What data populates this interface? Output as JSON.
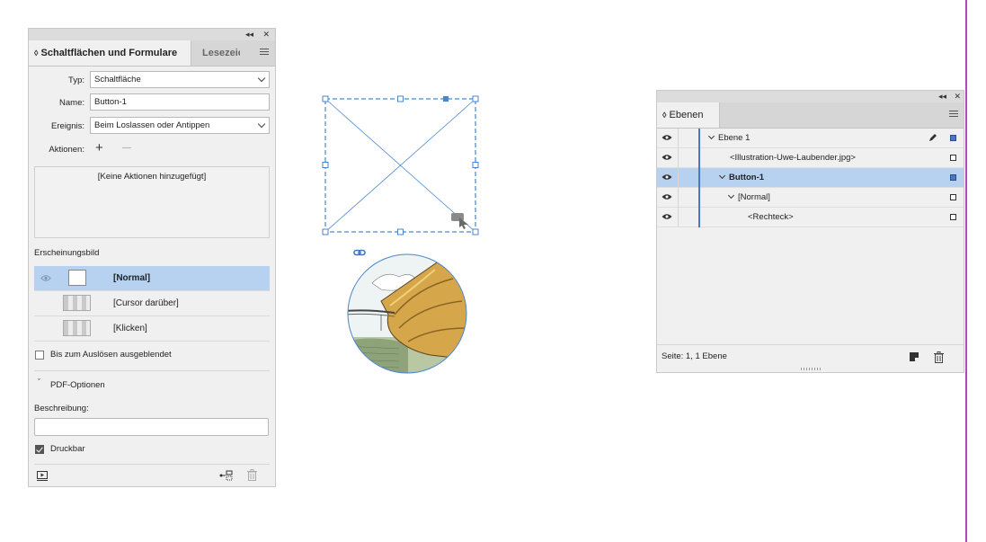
{
  "buttons_panel": {
    "tabs": [
      "Schaltflächen und Formulare",
      "Lesezeichen"
    ],
    "type_label": "Typ:",
    "type_value": "Schaltfläche",
    "name_label": "Name:",
    "name_value": "Button-1",
    "event_label": "Ereignis:",
    "event_value": "Beim Loslassen oder Antippen",
    "actions_label": "Aktionen:",
    "add_symbol": "+",
    "remove_symbol": "—",
    "no_actions": "[Keine Aktionen hinzugefügt]",
    "appearance_heading": "Erscheinungsbild",
    "appearances": [
      "[Normal]",
      "[Cursor darüber]",
      "[Klicken]"
    ],
    "hidden_label": "Bis zum Auslösen ausgeblendet",
    "pdf_options": "PDF-Optionen",
    "description_label": "Beschreibung:",
    "description_value": "",
    "printable_label": "Druckbar",
    "printable_checked": true
  },
  "layers_panel": {
    "tab": "Ebenen",
    "rows": [
      {
        "name": "Ebene 1",
        "square": "blue"
      },
      {
        "name": "<Illustration-Uwe-Laubender.jpg>",
        "square": "white"
      },
      {
        "name": "Button-1",
        "square": "blue"
      },
      {
        "name": "[Normal]",
        "square": "white"
      },
      {
        "name": "<Rechteck>",
        "square": "white"
      }
    ],
    "status": "Seite: 1, 1 Ebene"
  },
  "colors": {
    "accent": "#4a78c8",
    "selection": "#b7d2f0",
    "frame": "#4a86d0",
    "page_edge": "#b548b8"
  }
}
